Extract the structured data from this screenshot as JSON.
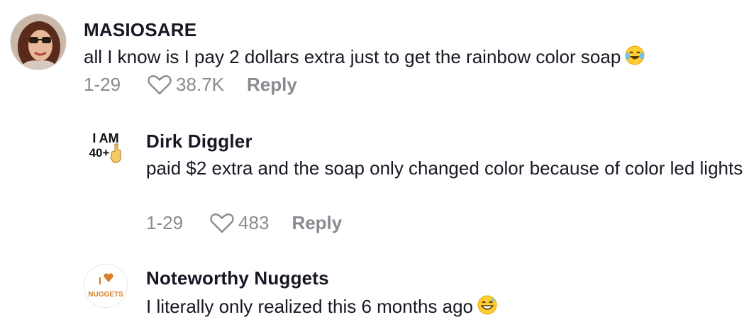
{
  "comments": [
    {
      "username": "MASIOSARE",
      "text": "all I know is I pay 2 dollars extra just to get the rainbow color soap",
      "emoji": "laughing-tears-emoji",
      "date": "1-29",
      "likes": "38.7K",
      "reply_label": "Reply"
    },
    {
      "username": "Dirk Diggler",
      "text": "paid $2 extra and the soap only changed color because of color led lights",
      "date": "1-29",
      "likes": "483",
      "reply_label": "Reply",
      "avatar_text_top": "I AM",
      "avatar_text_bottom": "40+"
    },
    {
      "username": "Noteworthy Nuggets",
      "text": "I literally only realized this 6 months ago",
      "emoji": "grinning-sweat-emoji",
      "avatar_text_top": "I",
      "avatar_text_bottom": "NUGGETS"
    }
  ],
  "colors": {
    "username": "#161823",
    "meta": "#8a8b91",
    "nugget_orange": "#d9822b"
  }
}
